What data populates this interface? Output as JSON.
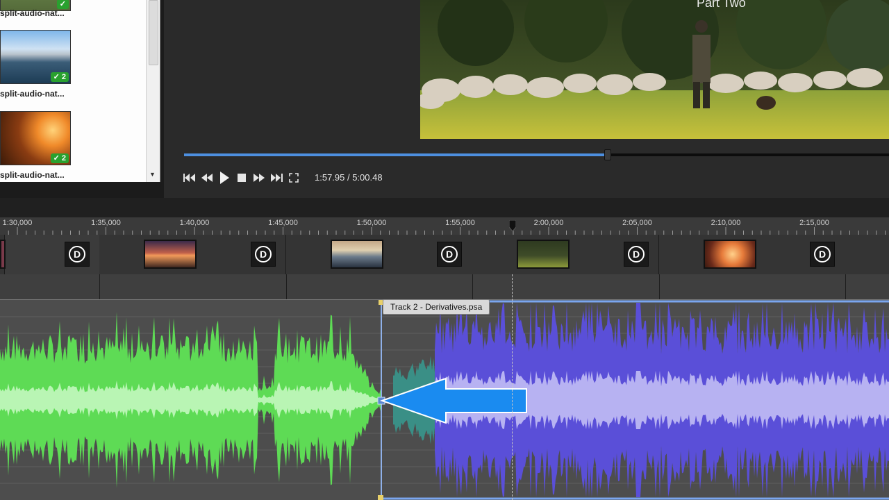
{
  "library": {
    "items": [
      {
        "label": "split-audio-nat...",
        "badge": ""
      },
      {
        "label": "split-audio-nat...",
        "badge": "2"
      },
      {
        "label": "split-audio-nat...",
        "badge": "2"
      }
    ]
  },
  "preview": {
    "caption": "Part Two",
    "time": "1:57.95 / 5:00.48",
    "progress": 0.6
  },
  "transport": {
    "icons": [
      "go-to-start-icon",
      "rewind-icon",
      "play-icon",
      "stop-icon",
      "fast-forward-icon",
      "go-to-end-icon",
      "fullscreen-icon"
    ]
  },
  "timeline": {
    "ticks": [
      "1:30,000",
      "1:35,000",
      "1:40,000",
      "1:45,000",
      "1:50,000",
      "1:55,000",
      "2:00,000",
      "2:05,000",
      "2:10,000",
      "2:15,000"
    ],
    "transition_glyph": "D",
    "audio_clip_name": "Track 2 - Derivatives.psa"
  },
  "colors": {
    "track1_wave": "#5edb55",
    "track1_core": "#b9f5b4",
    "track2_wave": "#5a4fd8",
    "track2_core": "#b7b2f2",
    "crossfade": "#3a8f86",
    "arrow": "#1a8bf0",
    "accent": "#4d8fe0"
  }
}
